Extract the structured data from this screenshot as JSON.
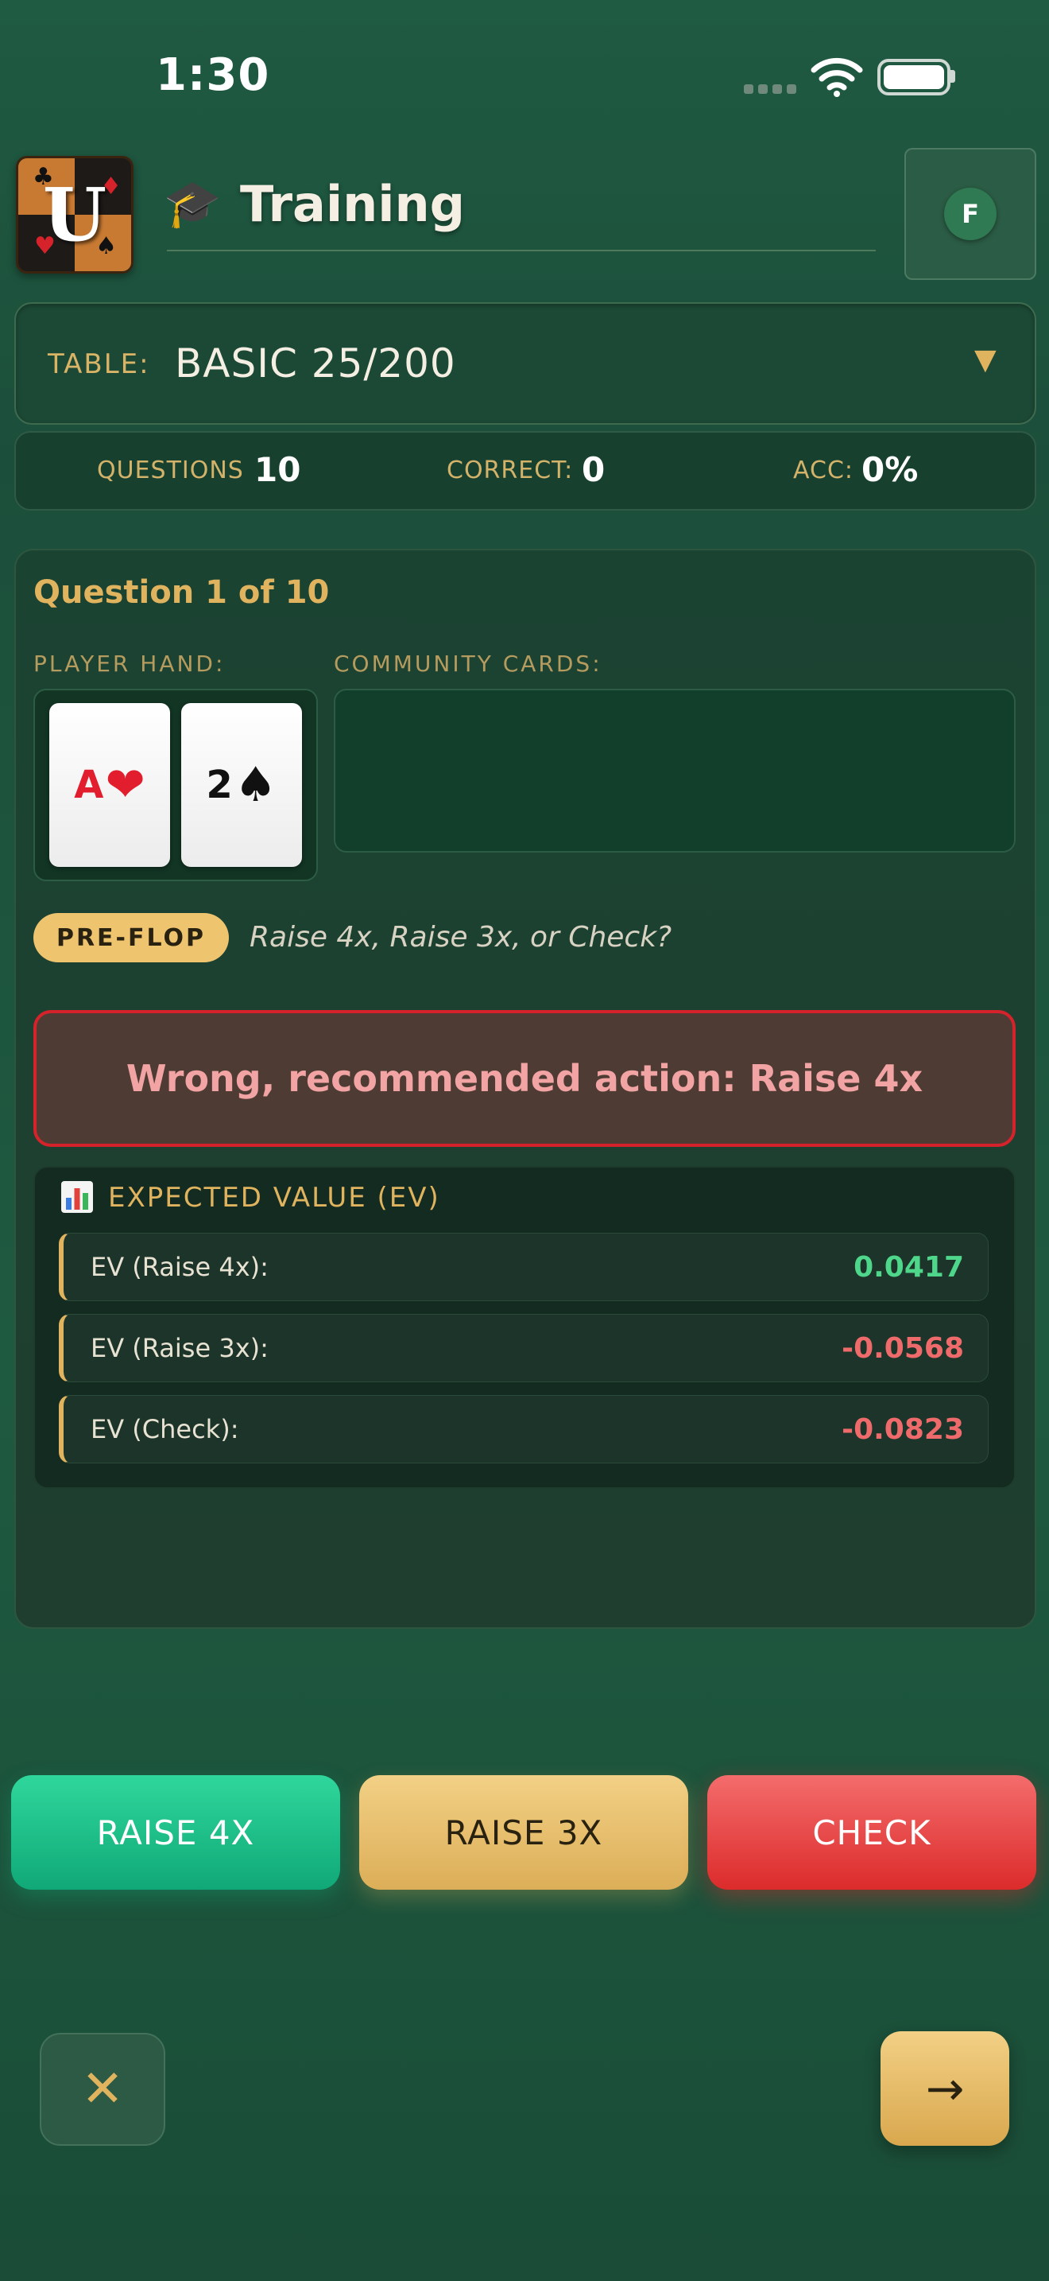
{
  "status_bar": {
    "time": "1:30",
    "icons": [
      "cellular-signal-icon",
      "wifi-icon",
      "battery-icon"
    ]
  },
  "header": {
    "logo_letter": "U",
    "logo_suits": [
      "♣",
      "♦",
      "♥",
      "♠"
    ],
    "title_icon": "🎓",
    "title": "Training",
    "avatar_initial": "F"
  },
  "table_selector": {
    "label": "TABLE:",
    "value": "BASIC 25/200",
    "caret": "▼"
  },
  "stats": {
    "questions_label": "QUESTIONS",
    "questions_value": "10",
    "correct_label": "CORRECT:",
    "correct_value": "0",
    "acc_label": "ACC:",
    "acc_value": "0%"
  },
  "question": {
    "title": "Question 1 of 10",
    "player_hand_label": "PLAYER HAND:",
    "community_label": "COMMUNITY CARDS:",
    "player_cards": [
      {
        "rank": "A",
        "suit": "❤",
        "color": "red"
      },
      {
        "rank": "2",
        "suit": "♠",
        "color": "black"
      }
    ],
    "community_cards": [],
    "street": "PRE-FLOP",
    "prompt": "Raise 4x, Raise 3x, or Check?"
  },
  "feedback": {
    "text": "Wrong, recommended action: Raise 4x",
    "color": "#d6232b"
  },
  "ev": {
    "icon": "bar-chart-icon",
    "title": "EXPECTED VALUE (EV)",
    "rows": [
      {
        "label": "EV (Raise 4x):",
        "value": "0.0417"
      },
      {
        "label": "EV (Raise 3x):",
        "value": "-0.0568"
      },
      {
        "label": "EV (Check):",
        "value": "-0.0823"
      }
    ]
  },
  "actions": {
    "raise4": "RAISE 4X",
    "raise3": "RAISE 3X",
    "check": "CHECK"
  },
  "nav": {
    "close": "✕",
    "next": "→"
  },
  "colors": {
    "accent_gold": "#e0b35e",
    "positive": "#4ed68a",
    "negative": "#ef6a6a",
    "raise4": "#10a877",
    "check": "#dc2b2b"
  }
}
